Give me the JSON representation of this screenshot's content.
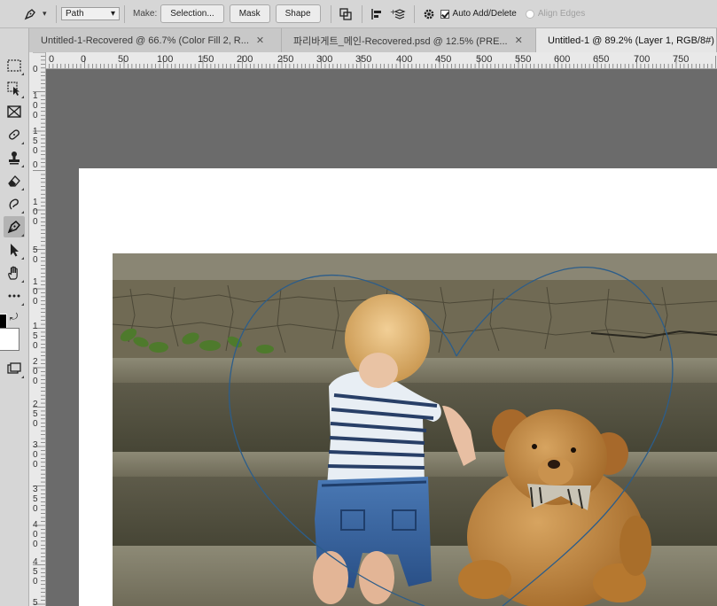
{
  "options_bar": {
    "mode_select": "Path",
    "make_label": "Make:",
    "selection_button": "Selection...",
    "mask_button": "Mask",
    "shape_button": "Shape",
    "auto_add_delete": "Auto Add/Delete",
    "auto_add_delete_checked": true,
    "align_edges": "Align Edges",
    "align_edges_enabled": false
  },
  "tabs": [
    {
      "label": "Untitled-1-Recovered @ 66.7% (Color Fill 2, R...",
      "active": false
    },
    {
      "label": "파리바게트_메인-Recovered.psd @ 12.5% (PRE...",
      "active": false
    },
    {
      "label": "Untitled-1 @ 89.2% (Layer 1, RGB/8#)",
      "active": true
    }
  ],
  "ruler": {
    "h_labels": [
      "0",
      "0",
      "50",
      "100",
      "150",
      "200",
      "250",
      "300",
      "350",
      "400",
      "450",
      "500",
      "550",
      "600",
      "650",
      "700",
      "750"
    ],
    "v_labels": [
      "0",
      "1\n0\n0",
      "1\n5\n0",
      "0",
      "1\n0\n0",
      "5\n0",
      "1\n0\n0",
      "1\n5\n0",
      "2\n0\n0",
      "2\n5\n0",
      "3\n0\n0",
      "3\n5\n0",
      "4\n0\n0",
      "4\n5\n0",
      "5\n0\n0"
    ]
  },
  "colors": {
    "accent": "#2c5d8a",
    "canvas_bg": "#6b6b6b",
    "chrome": "#d6d6d6"
  }
}
